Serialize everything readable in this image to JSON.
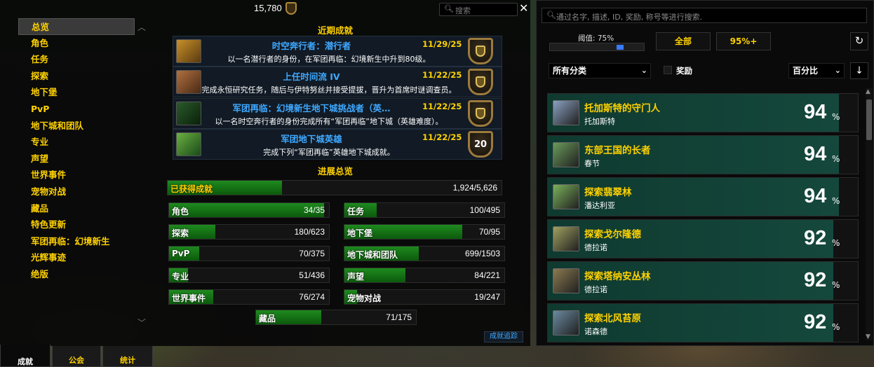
{
  "header": {
    "points": "15,780",
    "search_placeholder": "搜索",
    "close": "✕"
  },
  "categories": [
    {
      "label": "总览",
      "selected": true
    },
    {
      "label": "角色"
    },
    {
      "label": "任务"
    },
    {
      "label": "探索"
    },
    {
      "label": "地下堡"
    },
    {
      "label": "PvP"
    },
    {
      "label": "地下城和团队"
    },
    {
      "label": "专业"
    },
    {
      "label": "声望"
    },
    {
      "label": "世界事件"
    },
    {
      "label": "宠物对战"
    },
    {
      "label": "藏品"
    },
    {
      "label": "特色更新"
    },
    {
      "label": "军团再临：幻境新生"
    },
    {
      "label": "光辉事迹"
    },
    {
      "label": "绝版"
    }
  ],
  "recent": {
    "title": "近期成就",
    "items": [
      {
        "name": "时空奔行者：潜行者",
        "date": "11/29/25",
        "desc": "以一名潜行者的身份，在军团再临：幻境新生中升到80级。",
        "points": ""
      },
      {
        "name": "上任时间流 IV",
        "date": "11/22/25",
        "desc": "完成永恒研究任务，随后与伊特努丝并接受提拔，晋升为首席时谜调查员。",
        "points": ""
      },
      {
        "name": "军团再临：幻境新生地下城挑战者（英…",
        "date": "11/22/25",
        "desc": "以一名时空奔行者的身份完成所有“军团再临”地下城（英雄难度）。",
        "points": ""
      },
      {
        "name": "军团地下城英雄",
        "date": "11/22/25",
        "desc": "完成下列“军团再临”英雄地下城成就。",
        "points": "20"
      }
    ]
  },
  "progress": {
    "title": "进展总览",
    "total": {
      "label": "已获得成就",
      "value": "1,924/5,626",
      "fraction": 0.342
    },
    "bars": [
      {
        "label": "角色",
        "value": "34/35",
        "fraction": 0.971
      },
      {
        "label": "任务",
        "value": "100/495",
        "fraction": 0.202
      },
      {
        "label": "探索",
        "value": "180/623",
        "fraction": 0.289
      },
      {
        "label": "地下堡",
        "value": "70/95",
        "fraction": 0.737
      },
      {
        "label": "PvP",
        "value": "70/375",
        "fraction": 0.187
      },
      {
        "label": "地下城和团队",
        "value": "699/1503",
        "fraction": 0.465
      },
      {
        "label": "专业",
        "value": "51/436",
        "fraction": 0.117
      },
      {
        "label": "声望",
        "value": "84/221",
        "fraction": 0.38
      },
      {
        "label": "世界事件",
        "value": "76/274",
        "fraction": 0.277
      },
      {
        "label": "宠物对战",
        "value": "19/247",
        "fraction": 0.077
      },
      {
        "label": "藏品",
        "value": "71/175",
        "fraction": 0.406
      }
    ]
  },
  "tracking_button": "成就追踪",
  "tabs": [
    {
      "label": "成就"
    },
    {
      "label": "公会"
    },
    {
      "label": "统计"
    }
  ],
  "right": {
    "search_placeholder": "通过名字, 描述, ID, 奖励, 称号等进行搜索.",
    "threshold_label": "阈值: 75%",
    "threshold_fraction": 0.75,
    "btn_all": "全部",
    "btn_95": "95%+",
    "category_select": "所有分类",
    "reward_label": "奖励",
    "sort_select": "百分比",
    "sort_dir": "↓",
    "percent_sign": "%",
    "rows": [
      {
        "name": "托加斯特的守门人",
        "zone": "托加斯特",
        "pct": "94",
        "fraction": 0.94,
        "icon_color": "#8aa0c0"
      },
      {
        "name": "东部王国的长者",
        "zone": "春节",
        "pct": "94",
        "fraction": 0.94,
        "icon_color": "#6a9a5a"
      },
      {
        "name": "探索翡翠林",
        "zone": "潘达利亚",
        "pct": "94",
        "fraction": 0.94,
        "icon_color": "#7ab05a"
      },
      {
        "name": "探索戈尔隆德",
        "zone": "德拉诺",
        "pct": "92",
        "fraction": 0.92,
        "icon_color": "#a0a060"
      },
      {
        "name": "探索塔纳安丛林",
        "zone": "德拉诺",
        "pct": "92",
        "fraction": 0.92,
        "icon_color": "#8a7a50"
      },
      {
        "name": "探索北风苔原",
        "zone": "诺森德",
        "pct": "92",
        "fraction": 0.92,
        "icon_color": "#6a8aa0"
      }
    ]
  },
  "colors": {
    "gold": "#ffd200",
    "blue": "#3fa9ff",
    "bar_green": "#1e8a1e",
    "row_fill": "#15483c"
  }
}
